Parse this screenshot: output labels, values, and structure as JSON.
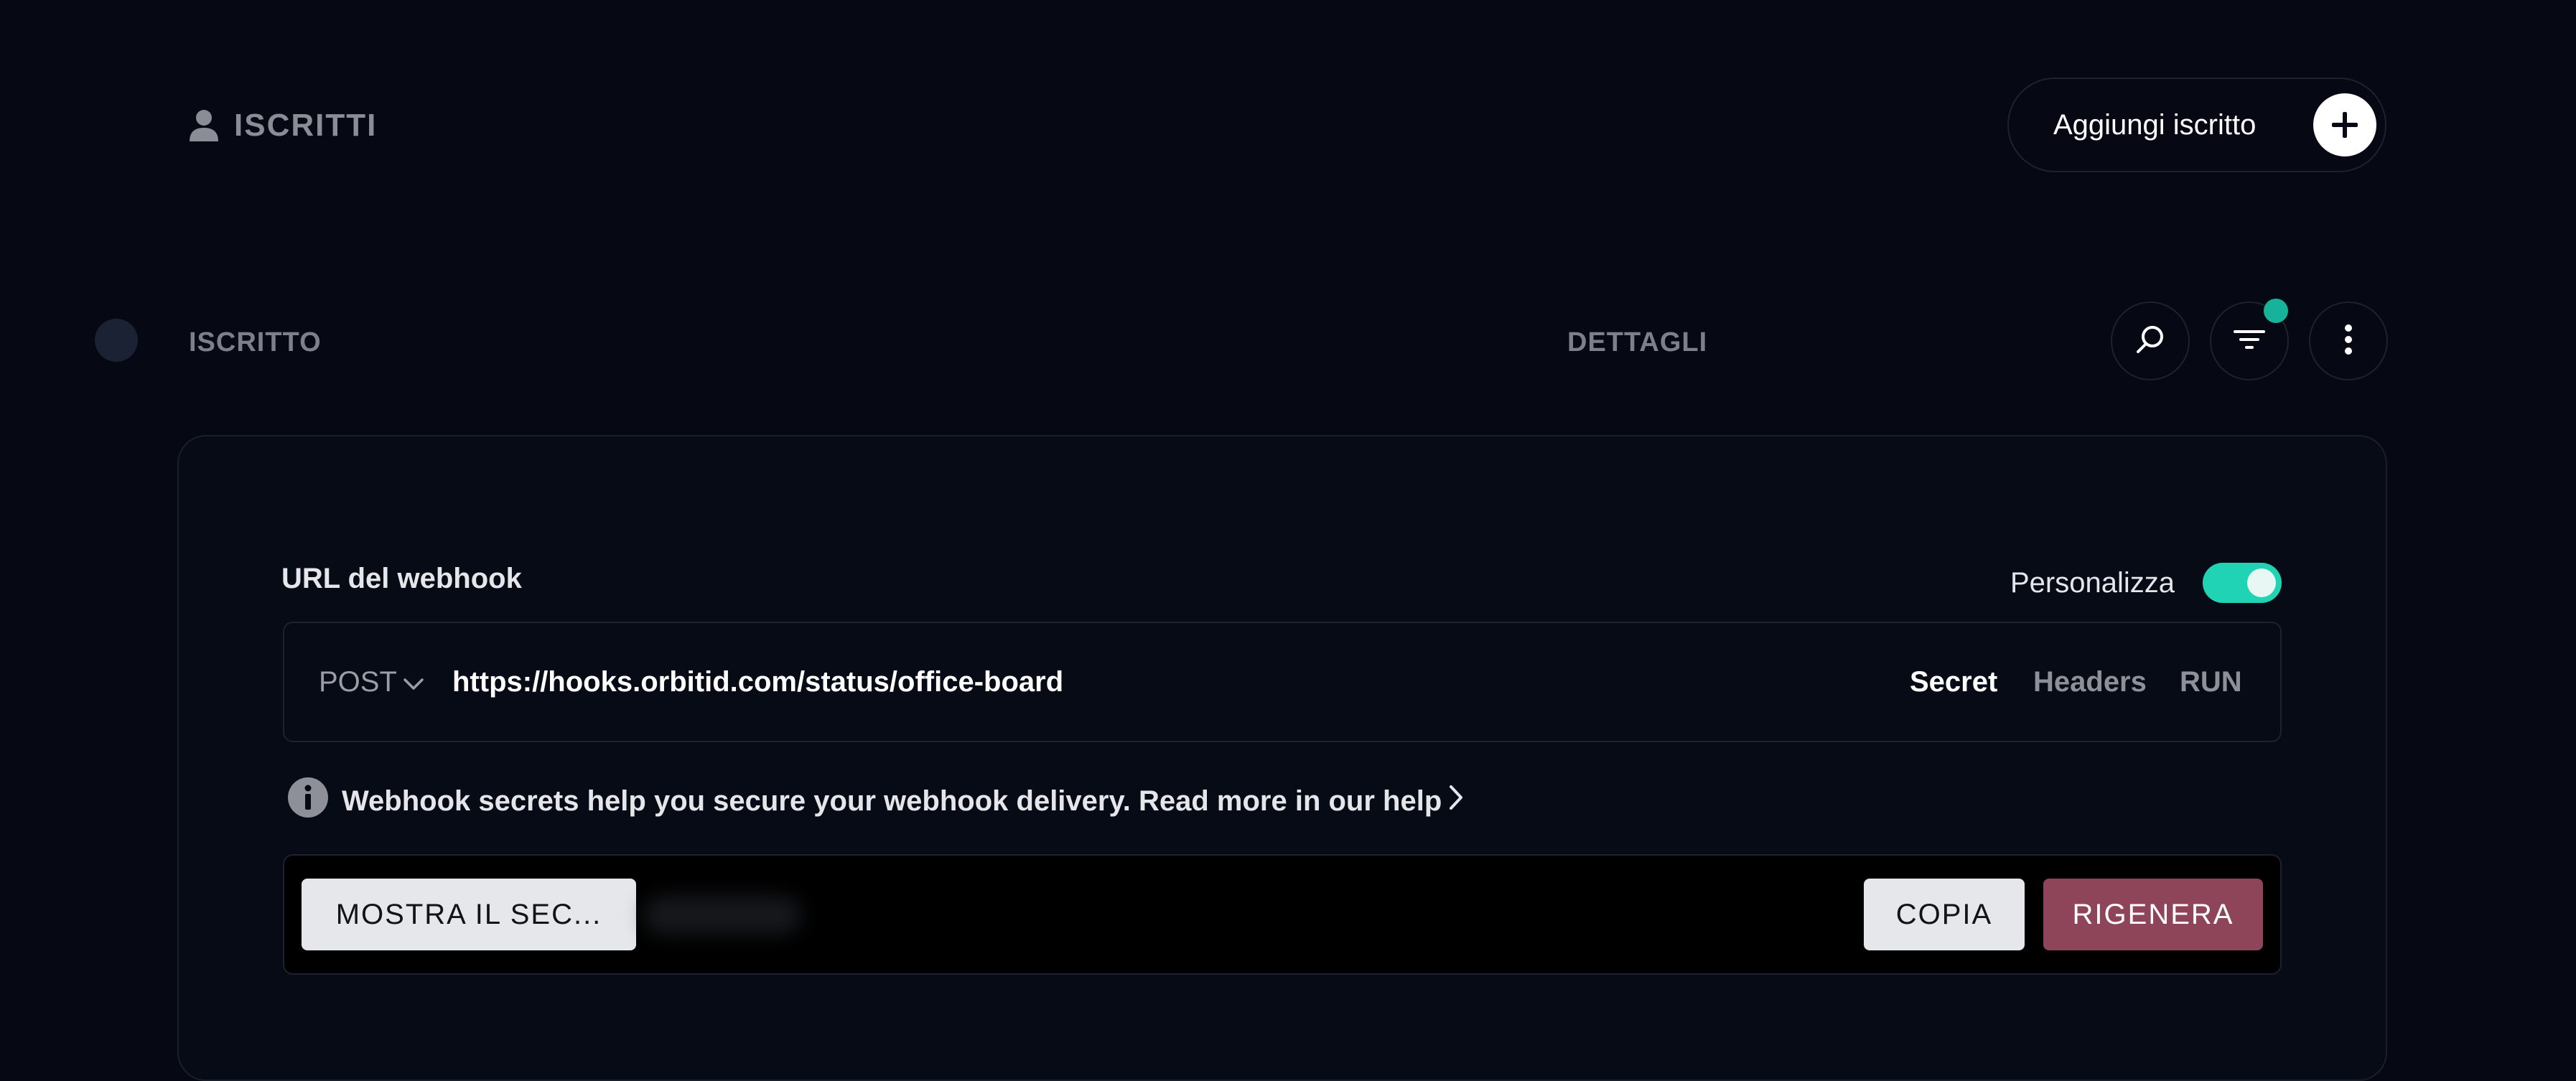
{
  "header": {
    "title": "ISCRITTI",
    "title_icon": "user-icon",
    "add_button_label": "Aggiungi iscritto",
    "add_button_icon": "plus-icon"
  },
  "table": {
    "columns": [
      "ISCRITTO",
      "DETTAGLI"
    ],
    "actions": [
      "search-icon",
      "filter-icon",
      "more-vertical-icon"
    ],
    "filter_active": true
  },
  "webhook": {
    "label": "URL del webhook",
    "customize_label": "Personalizza",
    "customize_enabled": true,
    "method": "POST",
    "url": "https://hooks.orbitid.com/status/office-board",
    "tabs": [
      {
        "label": "Secret",
        "active": true
      },
      {
        "label": "Headers",
        "active": false
      },
      {
        "label": "RUN",
        "active": false
      }
    ],
    "info_text": "Webhook secrets help you secure your webhook delivery. Read more in our help",
    "show_secret_label": "MOSTRA IL SEC...",
    "copy_label": "COPIA",
    "regenerate_label": "RIGENERA"
  },
  "colors": {
    "background": "#060913",
    "accent": "#1fd3b4",
    "danger": "#8f4559",
    "badge": "#16b39a"
  }
}
